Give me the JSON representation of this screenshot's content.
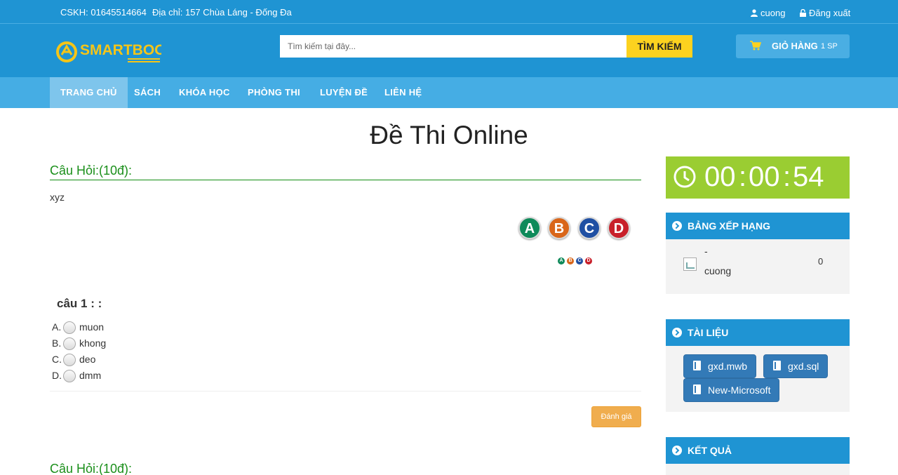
{
  "topbar": {
    "hotline": "CSKH: 01645514664",
    "address": "Địa chỉ: 157 Chùa Láng - Đống Đa",
    "user": "cuong",
    "logout": "Đăng xuất"
  },
  "header": {
    "logo_text": "SMARTBOOK",
    "search_placeholder": "Tìm kiếm tại đây...",
    "search_button": "TÌM KIẾM",
    "cart_label": "GIỎ HÀNG",
    "cart_count": "1 SP"
  },
  "nav": {
    "items": [
      "TRANG CHỦ",
      "SÁCH",
      "KHÓA HỌC",
      "PHÒNG THI",
      "LUYỆN ĐỀ",
      "LIÊN HỆ"
    ]
  },
  "page_title": "Đề Thi Online",
  "question": {
    "header": "Câu Hỏi:(10đ):",
    "text": "xyz",
    "badges": [
      "A",
      "B",
      "C",
      "D"
    ],
    "title": "câu 1 : :",
    "options": [
      {
        "letter": "A.",
        "text": "muon"
      },
      {
        "letter": "B.",
        "text": "khong"
      },
      {
        "letter": "C.",
        "text": "deo"
      },
      {
        "letter": "D.",
        "text": "dmm"
      }
    ],
    "submit": "Đánh giá"
  },
  "next_question_header": "Câu Hỏi:(10đ):",
  "timer": {
    "hh": "00",
    "mm": "00",
    "ss": "54",
    "sep": ":"
  },
  "ranking": {
    "title": "BẢNG XẾP HẠNG",
    "entries": [
      {
        "dash": "-",
        "name": "cuong",
        "score": "0"
      }
    ]
  },
  "documents": {
    "title": "TÀI LIỆU",
    "files": [
      "gxd.mwb",
      "gxd.sql",
      "New-Microsoft"
    ]
  },
  "results": {
    "title": "KẾT QUẢ"
  },
  "colors": {
    "primary": "#1f94d3",
    "nav": "#45ade4",
    "accent_yellow": "#fcd21f",
    "timer_green": "#9acd32",
    "question_green": "#1a8f1a",
    "badge_a": "#0f8a5a",
    "badge_b": "#d9661a",
    "badge_c": "#1f4fa3",
    "badge_d": "#c8202a"
  }
}
